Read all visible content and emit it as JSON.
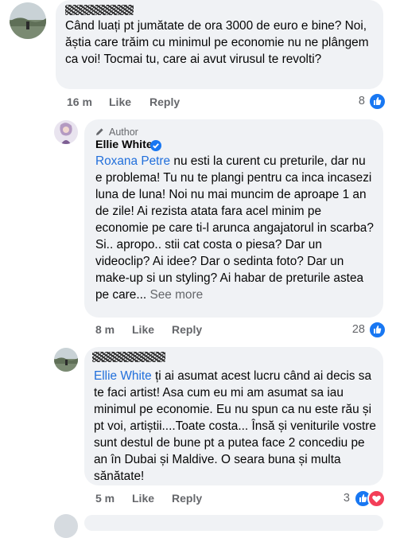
{
  "comments": [
    {
      "text": "Când luați pt jumătate de ora 3000 de euro e bine? Noi, ăștia care trăim cu minimul pe economie nu ne plângem ca voi! Tocmai tu, care ai avut virusul te revolti?",
      "time": "16 m",
      "like_label": "Like",
      "reply_label": "Reply",
      "reaction_count": "8",
      "reactions": [
        "like-icon"
      ]
    },
    {
      "author_tag": "Author",
      "author_name": "Ellie White",
      "mention": "Roxana Petre",
      "text": " nu esti la curent cu preturile, dar nu e problema! Tu nu te plangi pentru ca inca incasezi luna de luna! Noi nu mai muncim de aproape 1 an de zile! Ai rezista atata fara acel minim pe economie pe care ti-l arunca angajatorul in scarba? Si.. apropo.. stii cat costa o piesa? Dar un videoclip? Ai idee? Dar o sedinta foto? Dar un make-up si un styling? Ai habar de preturile astea pe care...",
      "see_more": "See more",
      "time": "8 m",
      "like_label": "Like",
      "reply_label": "Reply",
      "reaction_count": "28",
      "reactions": [
        "like-icon"
      ]
    },
    {
      "mention": "Ellie White",
      "text": " ți ai asumat acest lucru când ai decis sa te faci artist! Asa cum eu mi am asumat sa iau minimul pe economie. Eu nu spun ca nu este rău și pt voi, artiștii....Toate costa... Însă și veniturile vostre sunt destul de bune  pt a putea face 2 concediu pe an în Dubai și Maldive. O seara buna și multa sănătate!",
      "time": "5 m",
      "like_label": "Like",
      "reply_label": "Reply",
      "reaction_count": "3",
      "reactions": [
        "like-icon",
        "love-icon"
      ]
    }
  ],
  "colors": {
    "bubble": "#f0f2f5",
    "mention": "#216fdb",
    "meta": "#65676b",
    "like": "#1877f2",
    "love": "#f33e58"
  }
}
